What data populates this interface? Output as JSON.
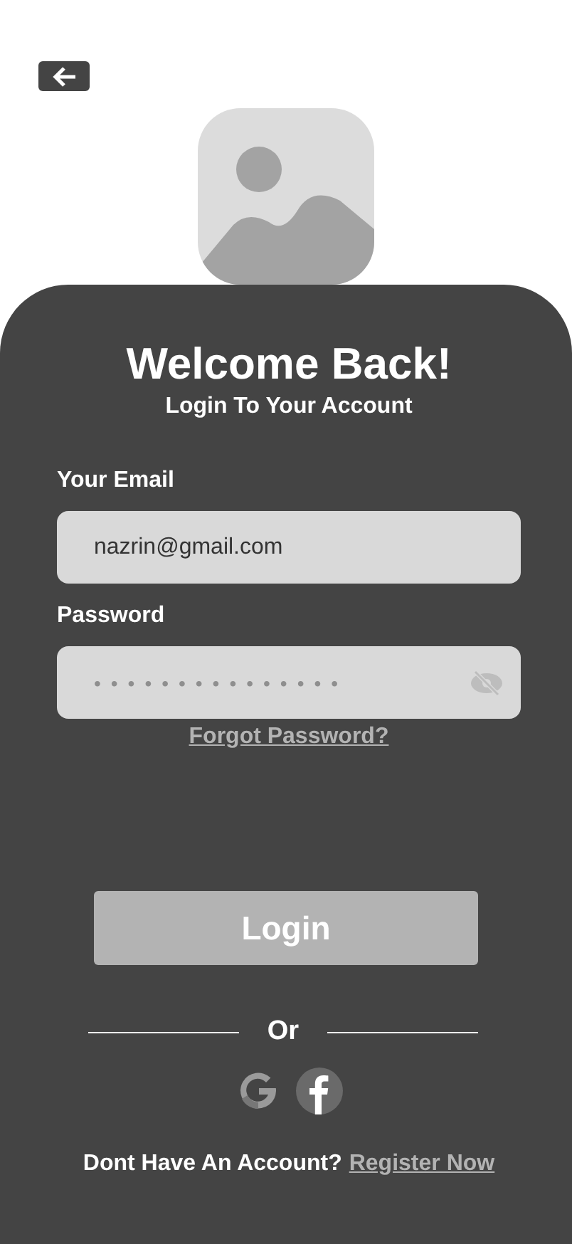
{
  "card": {
    "title": "Welcome Back!",
    "subtitle": "Login To Your Account",
    "fields": [
      {
        "kind": "text",
        "label": "Your Email",
        "value": "nazrin@gmail.com"
      },
      {
        "kind": "password",
        "label": "Password",
        "value": "•••••••••••••••"
      }
    ],
    "forgot_link": "Forgot Password?",
    "login_button": "Login",
    "divider": "Or",
    "footer": {
      "text": "Dont Have An Account?",
      "link": "Register Now"
    }
  }
}
